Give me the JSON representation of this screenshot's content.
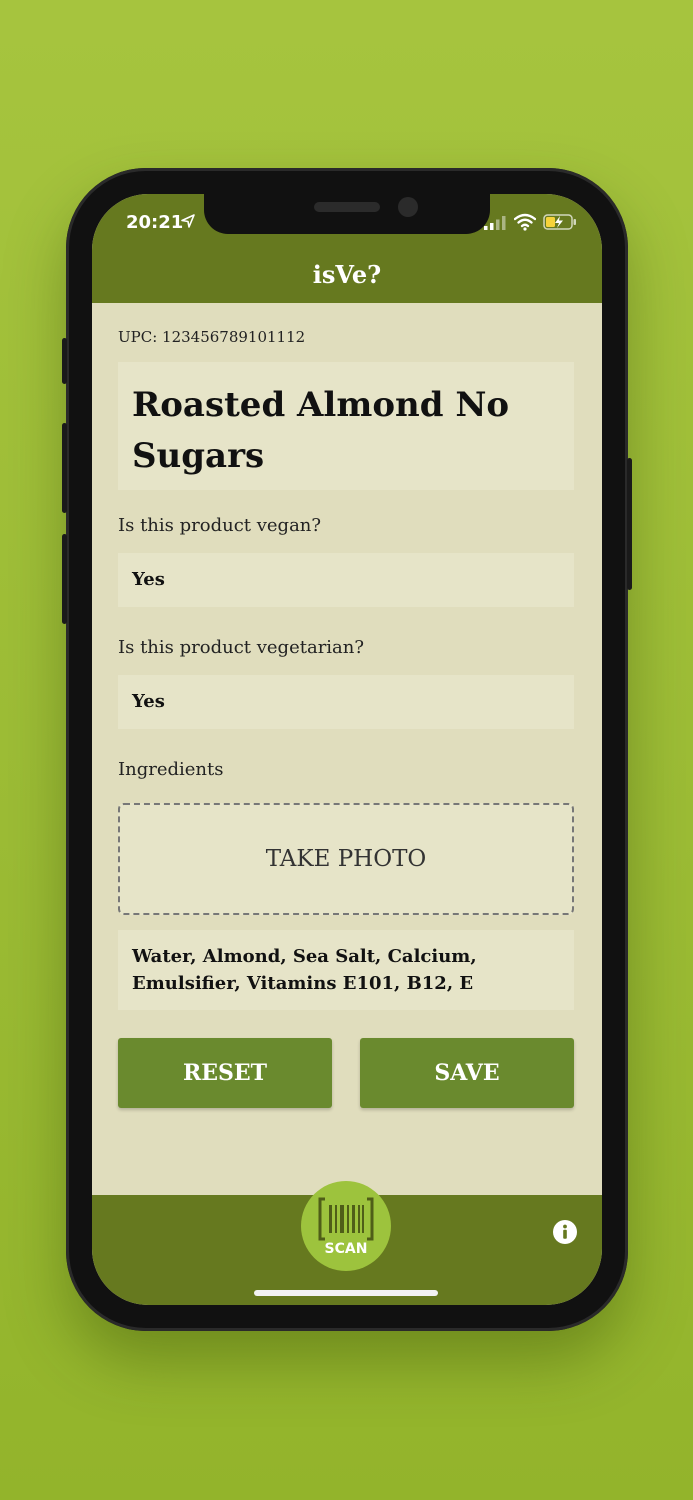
{
  "status_bar": {
    "time": "20:21"
  },
  "header": {
    "title": "isVe?"
  },
  "product": {
    "upc": "UPC: 123456789101112",
    "name": "Roasted Almond No Sugars"
  },
  "questions": {
    "vegan_label": "Is this product vegan?",
    "vegan_value": "Yes",
    "vegetarian_label": "Is this product vegetarian?",
    "vegetarian_value": "Yes"
  },
  "ingredients": {
    "label": "Ingredients",
    "take_photo": "TAKE PHOTO",
    "text": "Water, Almond, Sea Salt, Calcium, Emulsifier, Vitamins E101, B12, E"
  },
  "actions": {
    "reset": "RESET",
    "save": "SAVE"
  },
  "bottom_bar": {
    "scan_label": "SCAN",
    "info_icon": "info-icon"
  },
  "colors": {
    "background": "#a6c43e",
    "header": "#66791f",
    "content_bg": "#e0ddbd",
    "field_bg": "#e6e4c8",
    "button": "#6a8a2e",
    "scan": "#9dc33d"
  }
}
